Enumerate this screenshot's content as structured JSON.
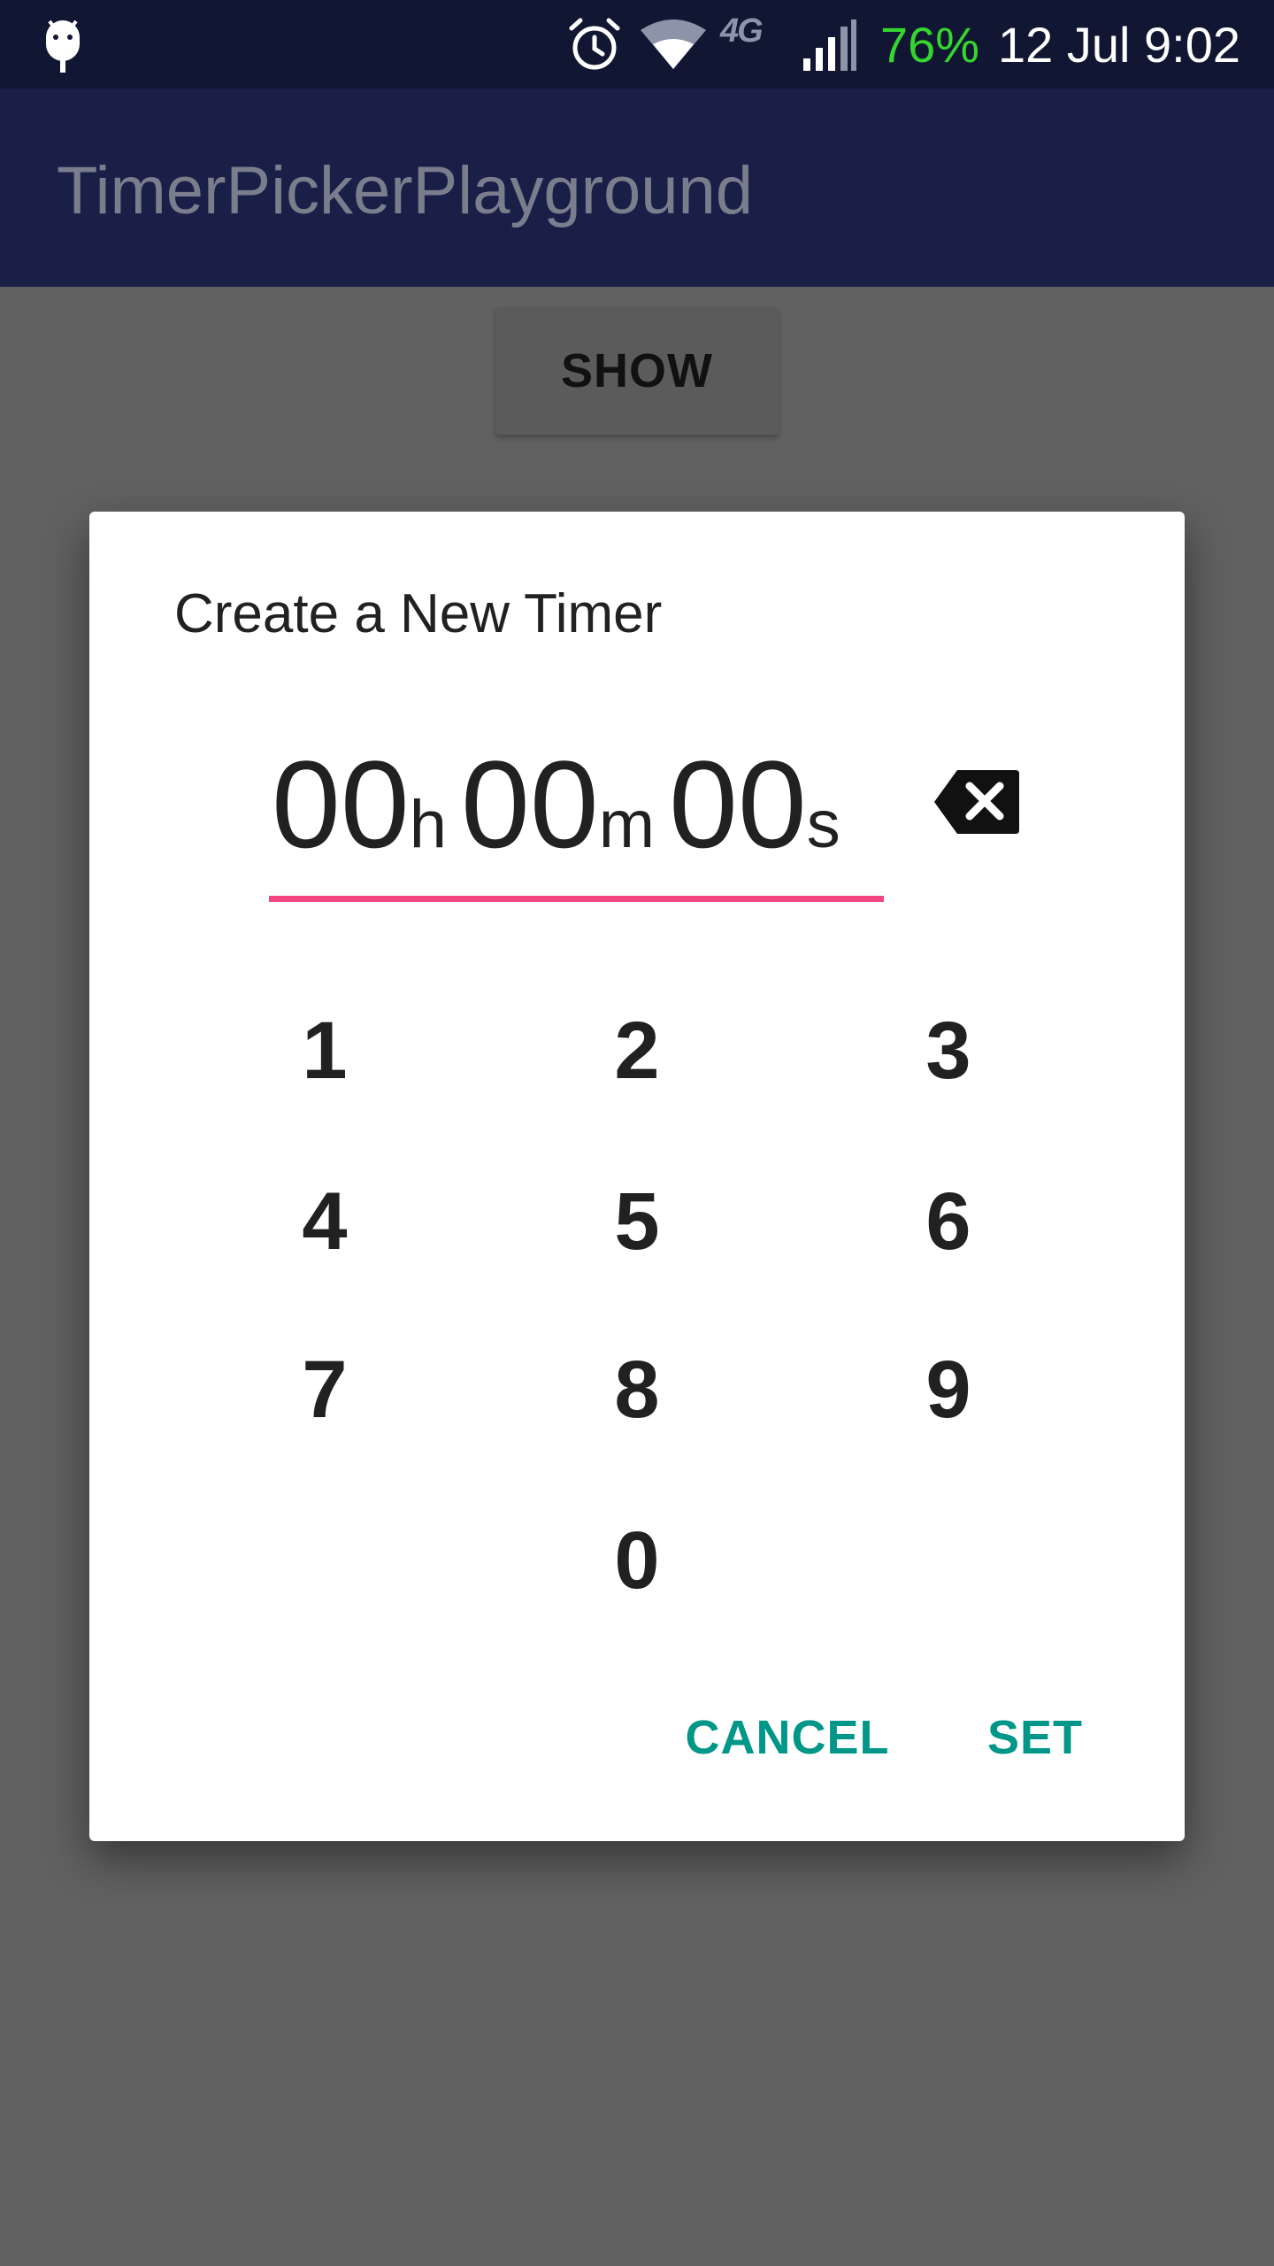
{
  "status_bar": {
    "network_label": "4G",
    "battery_text": "76%",
    "clock_text": "12 Jul 9:02",
    "icons": [
      "android-debug-icon",
      "alarm-icon",
      "wifi-icon",
      "cell-signal-icon"
    ],
    "battery_color": "#34d62f"
  },
  "app_bar": {
    "title": "TimerPickerPlayground",
    "background": "#1a1f48"
  },
  "main": {
    "show_button_label": "SHOW"
  },
  "dialog": {
    "title": "Create a New Timer",
    "timer": {
      "hours": "00",
      "hours_unit": "h",
      "minutes": "00",
      "minutes_unit": "m",
      "seconds": "00",
      "seconds_unit": "s"
    },
    "underline_color": "#f2467f",
    "backspace_icon": "backspace-icon",
    "keypad": [
      "1",
      "2",
      "3",
      "4",
      "5",
      "6",
      "7",
      "8",
      "9",
      "0"
    ],
    "actions": {
      "cancel_label": "CANCEL",
      "set_label": "SET",
      "color": "#009688"
    }
  }
}
